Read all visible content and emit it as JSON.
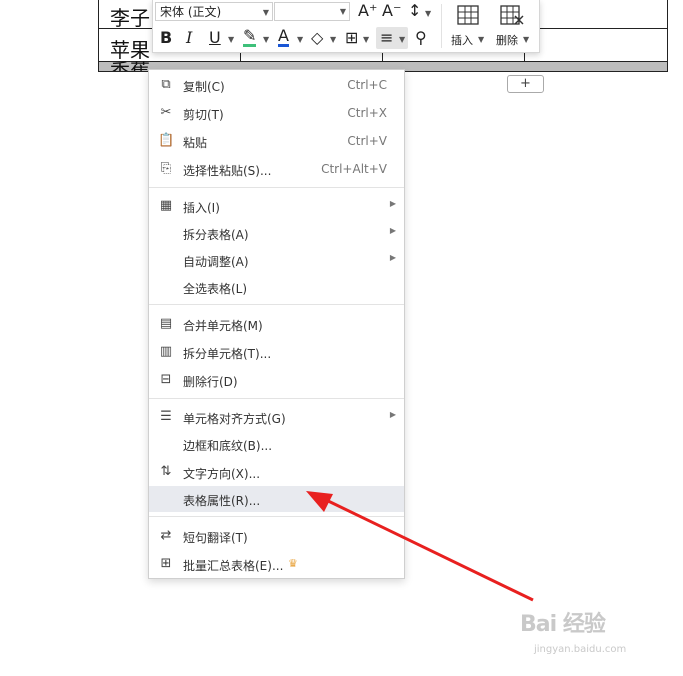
{
  "document": {
    "rows": [
      "李子",
      "苹果",
      "香蕉"
    ]
  },
  "toolbar": {
    "font_name": "宋体 (正文)",
    "font_size": "",
    "grow_font": "A⁺",
    "shrink_font": "A⁻",
    "line_spacing": "↕",
    "bold": "B",
    "italic": "I",
    "underline": "U",
    "highlight": "✎",
    "font_color": "A",
    "shading": "◇",
    "borders": "⊞",
    "align": "≡",
    "format_painter": "⚲",
    "insert_label": "插入",
    "delete_label": "删除",
    "accent_font_color": "#1a57d6",
    "accent_highlight": "#3ec07a"
  },
  "add_row_button": "+",
  "context_menu": {
    "items": [
      {
        "label": "复制(C)",
        "shortcut": "Ctrl+C",
        "icon": "copy-icon"
      },
      {
        "label": "剪切(T)",
        "shortcut": "Ctrl+X",
        "icon": "scissors-icon"
      },
      {
        "label": "粘贴",
        "shortcut": "Ctrl+V",
        "icon": "paste-icon"
      },
      {
        "label": "选择性粘贴(S)...",
        "shortcut": "Ctrl+Alt+V",
        "icon": "paste-special-icon"
      },
      {
        "label": "插入(I)",
        "submenu": true,
        "icon": "table-insert-icon"
      },
      {
        "label": "拆分表格(A)",
        "submenu": true
      },
      {
        "label": "自动调整(A)",
        "submenu": true
      },
      {
        "label": "全选表格(L)"
      },
      {
        "label": "合并单元格(M)",
        "icon": "merge-cells-icon"
      },
      {
        "label": "拆分单元格(T)...",
        "icon": "split-cells-icon"
      },
      {
        "label": "删除行(D)",
        "icon": "delete-row-icon"
      },
      {
        "label": "单元格对齐方式(G)",
        "submenu": true,
        "icon": "cell-align-icon"
      },
      {
        "label": "边框和底纹(B)..."
      },
      {
        "label": "文字方向(X)...",
        "icon": "text-direction-icon"
      },
      {
        "label": "表格属性(R)...",
        "highlighted": true
      },
      {
        "label": "短句翻译(T)",
        "icon": "translate-icon"
      },
      {
        "label": "批量汇总表格(E)...",
        "icon": "batch-summary-icon",
        "premium": true
      }
    ]
  },
  "watermark": {
    "brand": "Bai 经验",
    "site": "jingyan.baidu.com"
  },
  "colors": {
    "annotation_arrow": "#e8201f",
    "highlight_row": "#e8eaef",
    "crown": "#e8a23a"
  }
}
